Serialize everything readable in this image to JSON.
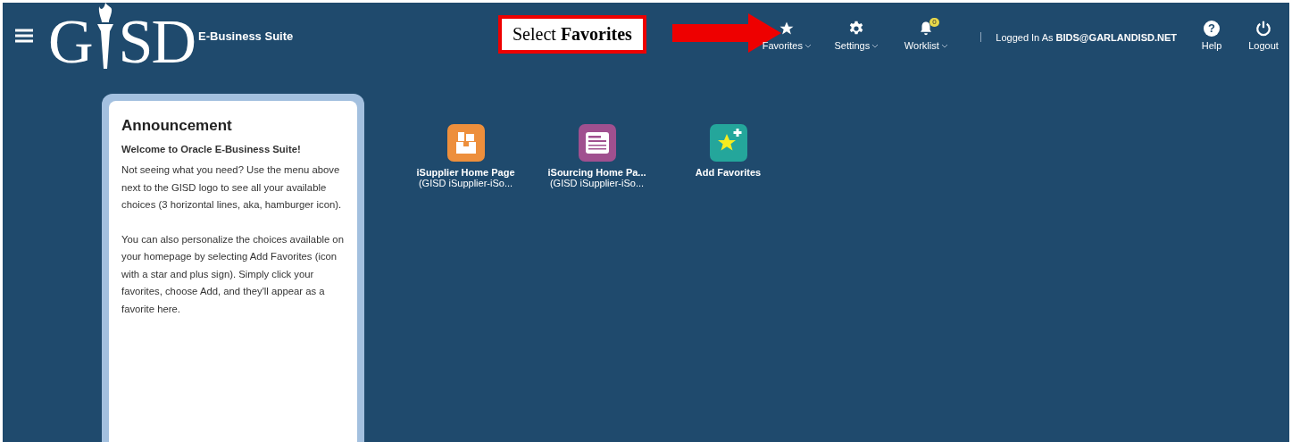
{
  "header": {
    "logo": {
      "left": "G",
      "right": "SD"
    },
    "app_name": "E-Business Suite",
    "callout": {
      "text": "Select **Favorites**"
    },
    "nav": [
      {
        "kind": "star",
        "label": "Favorites",
        "dropdown": true
      },
      {
        "kind": "gear",
        "label": "Settings",
        "dropdown": true
      },
      {
        "kind": "bell",
        "label": "Worklist",
        "dropdown": true,
        "badge": "0"
      }
    ],
    "user": {
      "prefix": "Logged In As",
      "name": "BIDS@GARLANDISD.NET"
    },
    "actions": [
      {
        "kind": "help",
        "label": "Help",
        "glyph": "?"
      },
      {
        "kind": "power",
        "label": "Logout"
      }
    ]
  },
  "announcement": {
    "title": "Announcement",
    "subtitle": "Welcome to Oracle E-Business Suite!",
    "paragraphs": [
      "Not seeing what you need? Use the menu above next to the GISD logo to see all your available choices (3 horizontal lines, aka, hamburger icon).",
      "You can also personalize the choices available on your homepage by selecting Add Favorites (icon with a star and plus sign). Simply click your favorites, choose Add, and they'll appear as a favorite here."
    ]
  },
  "tiles": [
    {
      "kind": "supplier",
      "title": "iSupplier Home Page",
      "subtitle": "(GISD iSupplier-iSo..."
    },
    {
      "kind": "sourcing",
      "title": "iSourcing Home Pa...",
      "subtitle": "(GISD iSupplier-iSo..."
    },
    {
      "kind": "add",
      "title": "Add Favorites"
    }
  ]
}
